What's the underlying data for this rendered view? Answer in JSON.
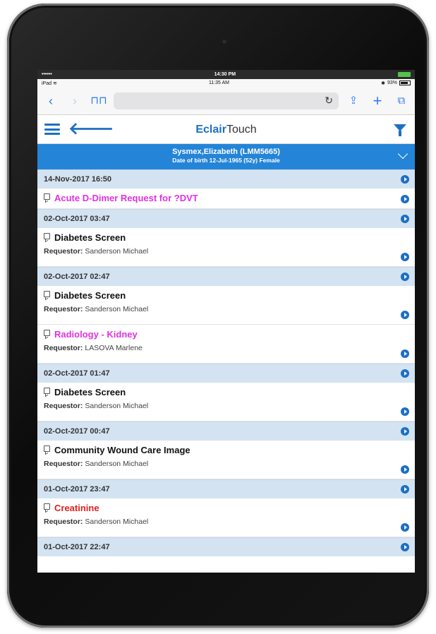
{
  "status_bar": {
    "carrier": "••••••",
    "time": "14:30 PM"
  },
  "ios_status": {
    "device": "iPad",
    "time": "11:35 AM",
    "battery": "93%"
  },
  "browser": {
    "url": "",
    "icons": [
      "back-icon",
      "forward-icon",
      "bookmarks-icon",
      "reload-icon",
      "share-icon",
      "new-tab-icon",
      "tabs-icon"
    ]
  },
  "app": {
    "title_brand": "Eclair",
    "title_rest": "Touch"
  },
  "patient": {
    "name": "Sysmex,Elizabeth (LMM5665)",
    "dob": "Date of birth 12-Jul-1965 (52y) Female"
  },
  "colors": {
    "accent": "#1c6fc4",
    "patient_bar": "#2485d8",
    "date_row": "#d3e3f1",
    "magenta": "#e230e2",
    "red": "#e02020"
  },
  "groups": [
    {
      "date": "14-Nov-2017 16:50",
      "items": [
        {
          "title": "Acute D-Dimer Request for ?DVT",
          "style": "magenta",
          "requestor_label": "",
          "requestor": ""
        }
      ]
    },
    {
      "date": "02-Oct-2017 03:47",
      "items": [
        {
          "title": "Diabetes Screen",
          "style": "normal",
          "requestor_label": "Requestor:",
          "requestor": "Sanderson Michael"
        }
      ]
    },
    {
      "date": "02-Oct-2017 02:47",
      "items": [
        {
          "title": "Diabetes Screen",
          "style": "normal",
          "requestor_label": "Requestor:",
          "requestor": "Sanderson Michael"
        },
        {
          "title": "Radiology - Kidney",
          "style": "magenta",
          "requestor_label": "Requestor:",
          "requestor": "LASOVA Marlene"
        }
      ]
    },
    {
      "date": "02-Oct-2017 01:47",
      "items": [
        {
          "title": "Diabetes Screen",
          "style": "normal",
          "requestor_label": "Requestor:",
          "requestor": "Sanderson Michael"
        }
      ]
    },
    {
      "date": "02-Oct-2017 00:47",
      "items": [
        {
          "title": "Community Wound Care Image",
          "style": "normal",
          "requestor_label": "Requestor:",
          "requestor": "Sanderson Michael"
        }
      ]
    },
    {
      "date": "01-Oct-2017 23:47",
      "items": [
        {
          "title": "Creatinine",
          "style": "red",
          "requestor_label": "Requestor:",
          "requestor": "Sanderson Michael"
        }
      ]
    },
    {
      "date": "01-Oct-2017 22:47",
      "items": []
    }
  ]
}
